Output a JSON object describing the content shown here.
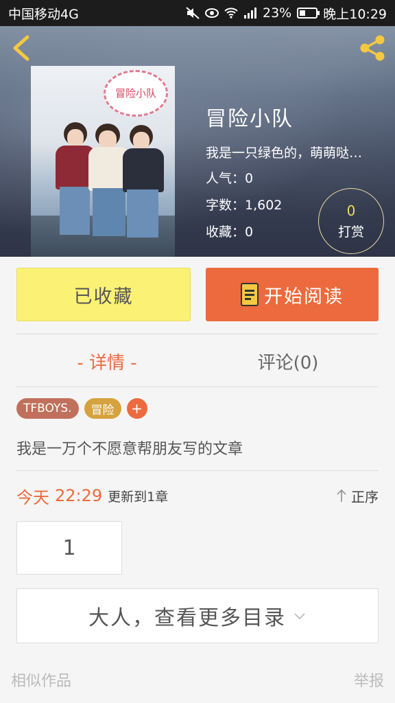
{
  "status_bar": {
    "carrier": "中国移动4G",
    "battery": "23%",
    "time": "晚上10:29",
    "icons": [
      "mute-icon",
      "eye-icon",
      "wifi-icon",
      "signal-icon",
      "battery-icon"
    ]
  },
  "header": {
    "back_icon": "chevron-left-icon",
    "share_icon": "share-icon",
    "cover_bubble_text": "冒险小队"
  },
  "book": {
    "title": "冒险小队",
    "description": "我是一只绿色的，萌萌哒…",
    "popularity": "人气：0",
    "word_count": "字数：1,602",
    "favorites": "收藏：0",
    "reward_count": "0",
    "reward_label": "打赏"
  },
  "actions": {
    "collected_label": "已收藏",
    "start_reading_label": "开始阅读"
  },
  "tabs": {
    "detail": "- 详情 -",
    "comment": "评论(0)"
  },
  "tags": [
    "TFBOYS.",
    "冒险"
  ],
  "tag_add": "+",
  "summary": "我是一万个不愿意帮朋友写的文章",
  "update": {
    "day": "今天",
    "time": "22:29",
    "text": "更新到1章",
    "order_label": "正序"
  },
  "chapters": [
    "1"
  ],
  "more_catalog_label": "大人，查看更多目录",
  "footer": {
    "similar": "相似作品",
    "report": "举报"
  },
  "colors": {
    "accent": "#ec6a3d",
    "collected_bg": "#fbf275",
    "status_bar_bg": "#1c1c1c"
  }
}
